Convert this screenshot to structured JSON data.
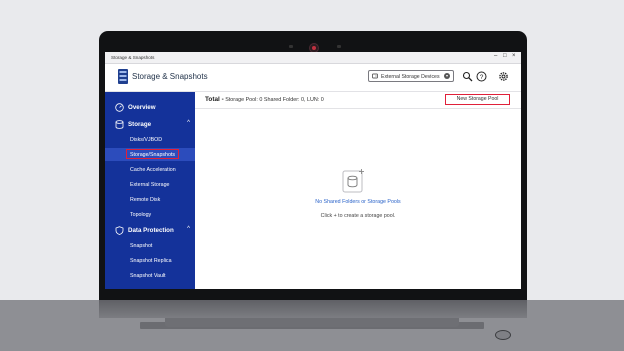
{
  "window": {
    "title": "Storage & Snapshots",
    "controls": [
      "–",
      "□",
      "×"
    ]
  },
  "header": {
    "app_title": "Storage & Snapshots",
    "external_select": {
      "value": "External Storage Devices",
      "dropdown_icon": "chevron-down-icon"
    },
    "icons": [
      "search-icon",
      "help-icon",
      "gear-icon"
    ]
  },
  "sidebar": {
    "overview": "Overview",
    "storage": {
      "label": "Storage",
      "items": [
        "Disks/VJBOD",
        "Storage/Snapshots",
        "Cache Acceleration",
        "External Storage",
        "Remote Disk",
        "Topology"
      ],
      "selected": "Storage/Snapshots"
    },
    "data_protection": {
      "label": "Data Protection",
      "items": [
        "Snapshot",
        "Snapshot Replica",
        "Snapshot Vault"
      ]
    }
  },
  "main": {
    "summary": {
      "total_label": "Total -",
      "storage_pool": "Storage Pool: 0",
      "shared_folder": "Shared Folder: 0",
      "lun": "LUN: 0"
    },
    "new_pool_button": "New Storage Pool",
    "empty": {
      "title": "No Shared Folders or Storage Pools",
      "hint": "Click + to create a storage pool."
    }
  },
  "colors": {
    "sidebar": "#14329a",
    "selected": "#2c4cbc",
    "highlight": "#e0203a",
    "link": "#2a63c9"
  }
}
